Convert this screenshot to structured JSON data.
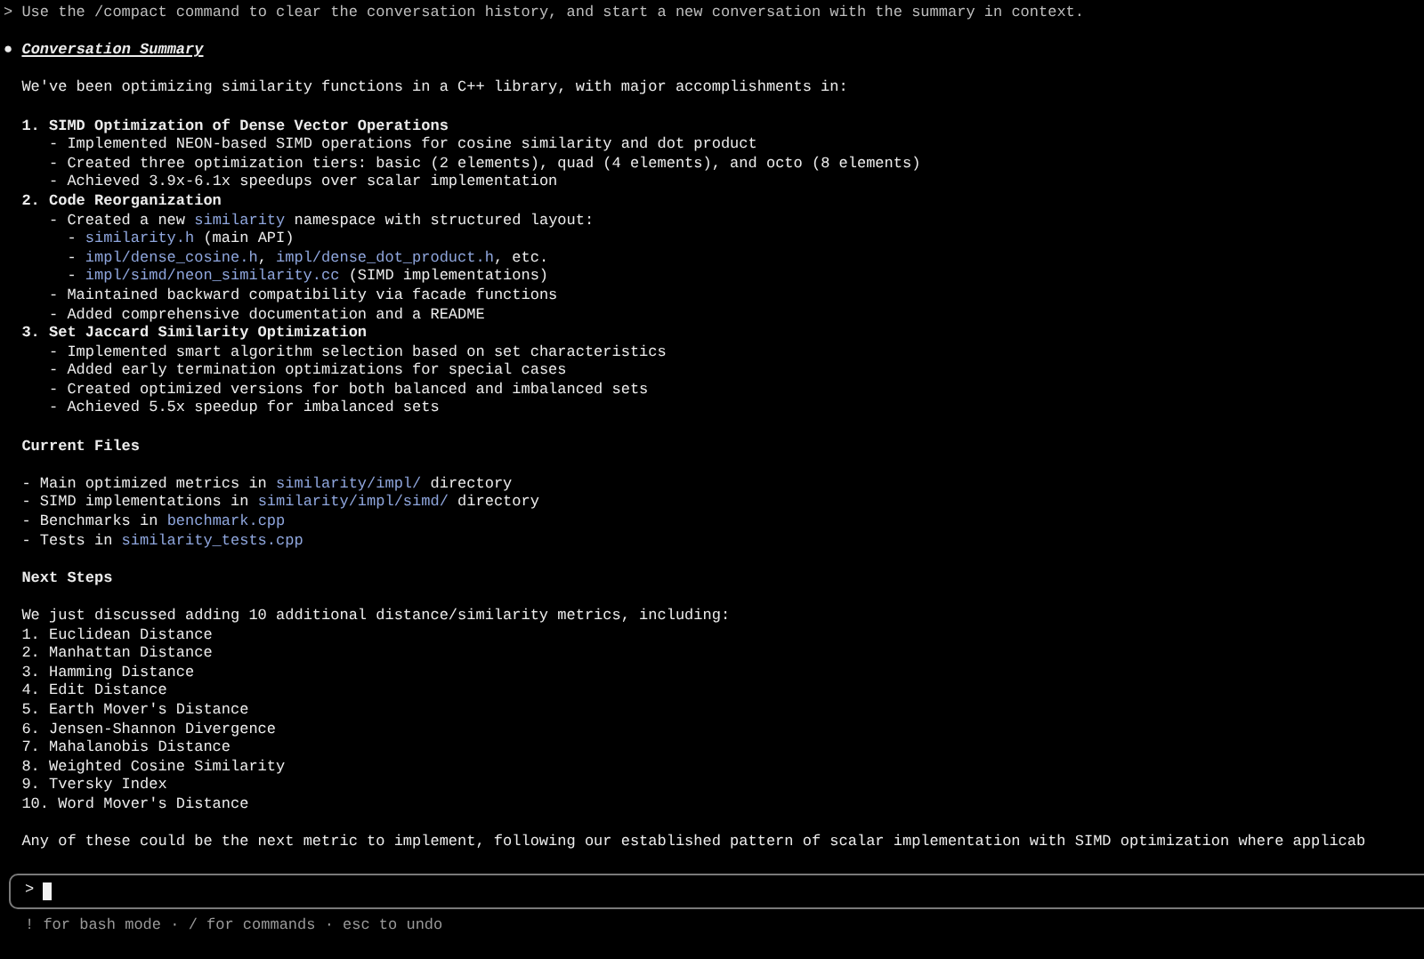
{
  "previous_prompt": "> Use the /compact command to clear the conversation history, and start a new conversation with the summary in context.",
  "summary": {
    "bullet": "●",
    "title": "Conversation Summary",
    "intro": "We've been optimizing similarity functions in a C++ library, with major accomplishments in:",
    "accomplishments": [
      {
        "number": "1.",
        "title": "SIMD Optimization of Dense Vector Operations",
        "items": [
          {
            "parts": [
              {
                "text": "- Implemented NEON-based SIMD operations for cosine similarity and dot product",
                "code": false
              }
            ]
          },
          {
            "parts": [
              {
                "text": "- Created three optimization tiers: basic (2 elements), quad (4 elements), and octo (8 elements)",
                "code": false
              }
            ]
          },
          {
            "parts": [
              {
                "text": "- Achieved 3.9x-6.1x speedups over scalar implementation",
                "code": false
              }
            ]
          }
        ]
      },
      {
        "number": "2.",
        "title": "Code Reorganization",
        "items": [
          {
            "parts": [
              {
                "text": "- Created a new ",
                "code": false
              },
              {
                "text": "similarity",
                "code": true
              },
              {
                "text": " namespace with structured layout:",
                "code": false
              }
            ],
            "children": [
              {
                "parts": [
                  {
                    "text": "- ",
                    "code": false
                  },
                  {
                    "text": "similarity.h",
                    "code": true
                  },
                  {
                    "text": " (main API)",
                    "code": false
                  }
                ]
              },
              {
                "parts": [
                  {
                    "text": "- ",
                    "code": false
                  },
                  {
                    "text": "impl/dense_cosine.h",
                    "code": true
                  },
                  {
                    "text": ", ",
                    "code": false
                  },
                  {
                    "text": "impl/dense_dot_product.h",
                    "code": true
                  },
                  {
                    "text": ", etc.",
                    "code": false
                  }
                ]
              },
              {
                "parts": [
                  {
                    "text": "- ",
                    "code": false
                  },
                  {
                    "text": "impl/simd/neon_similarity.cc",
                    "code": true
                  },
                  {
                    "text": " (SIMD implementations)",
                    "code": false
                  }
                ]
              }
            ]
          },
          {
            "parts": [
              {
                "text": "- Maintained backward compatibility via facade functions",
                "code": false
              }
            ]
          },
          {
            "parts": [
              {
                "text": "- Added comprehensive documentation and a README",
                "code": false
              }
            ]
          }
        ]
      },
      {
        "number": "3.",
        "title": "Set Jaccard Similarity Optimization",
        "items": [
          {
            "parts": [
              {
                "text": "- Implemented smart algorithm selection based on set characteristics",
                "code": false
              }
            ]
          },
          {
            "parts": [
              {
                "text": "- Added early termination optimizations for special cases",
                "code": false
              }
            ]
          },
          {
            "parts": [
              {
                "text": "- Created optimized versions for both balanced and imbalanced sets",
                "code": false
              }
            ]
          },
          {
            "parts": [
              {
                "text": "- Achieved 5.5x speedup for imbalanced sets",
                "code": false
              }
            ]
          }
        ]
      }
    ],
    "current_files": {
      "heading": "Current Files",
      "items": [
        {
          "parts": [
            {
              "text": "- Main optimized metrics in ",
              "code": false
            },
            {
              "text": "similarity/impl/",
              "code": true
            },
            {
              "text": " directory",
              "code": false
            }
          ]
        },
        {
          "parts": [
            {
              "text": "- SIMD implementations in ",
              "code": false
            },
            {
              "text": "similarity/impl/simd/",
              "code": true
            },
            {
              "text": " directory",
              "code": false
            }
          ]
        },
        {
          "parts": [
            {
              "text": "- Benchmarks in ",
              "code": false
            },
            {
              "text": "benchmark.cpp",
              "code": true
            }
          ]
        },
        {
          "parts": [
            {
              "text": "- Tests in ",
              "code": false
            },
            {
              "text": "similarity_tests.cpp",
              "code": true
            }
          ]
        }
      ]
    },
    "next_steps": {
      "heading": "Next Steps",
      "intro": "We just discussed adding 10 additional distance/similarity metrics, including:",
      "metrics": [
        "1. Euclidean Distance",
        "2. Manhattan Distance",
        "3. Hamming Distance",
        "4. Edit Distance",
        "5. Earth Mover's Distance",
        "6. Jensen-Shannon Divergence",
        "7. Mahalanobis Distance",
        "8. Weighted Cosine Similarity",
        "9. Tversky Index",
        "10. Word Mover's Distance"
      ],
      "closing": "Any of these could be the next metric to implement, following our established pattern of scalar implementation with SIMD optimization where applicab"
    }
  },
  "input": {
    "prompt": ">",
    "cursor": true
  },
  "footer": "! for bash mode · / for commands · esc to undo"
}
